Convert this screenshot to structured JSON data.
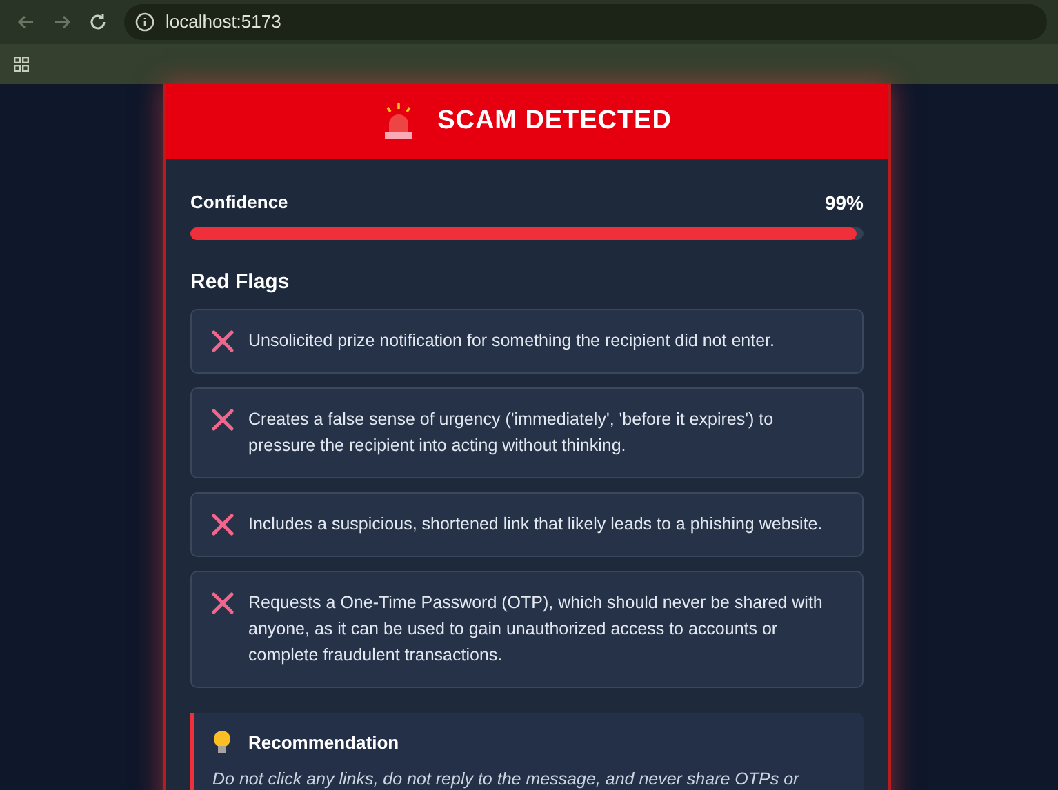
{
  "browser": {
    "url": "localhost:5173"
  },
  "result": {
    "title": "SCAM DETECTED",
    "confidence_label": "Confidence",
    "confidence_value": "99%",
    "level": 0.99,
    "red_flags_title": "Red Flags",
    "red_flags": [
      {
        "text": "Unsolicited prize notification for something the recipient did not enter."
      },
      {
        "text": "Creates a false sense of urgency ('immediately', 'before it expires') to pressure the recipient into acting without thinking."
      },
      {
        "text": "Includes a suspicious, shortened link that likely leads to a phishing website."
      },
      {
        "text": "Requests a One-Time Password (OTP), which should never be shared with anyone, as it can be used to gain unauthorized access to accounts or complete fraudulent transactions."
      }
    ],
    "recommendation_title": "Recommendation",
    "recommendation_text": "Do not click any links, do not reply to the message, and never share OTPs or"
  }
}
